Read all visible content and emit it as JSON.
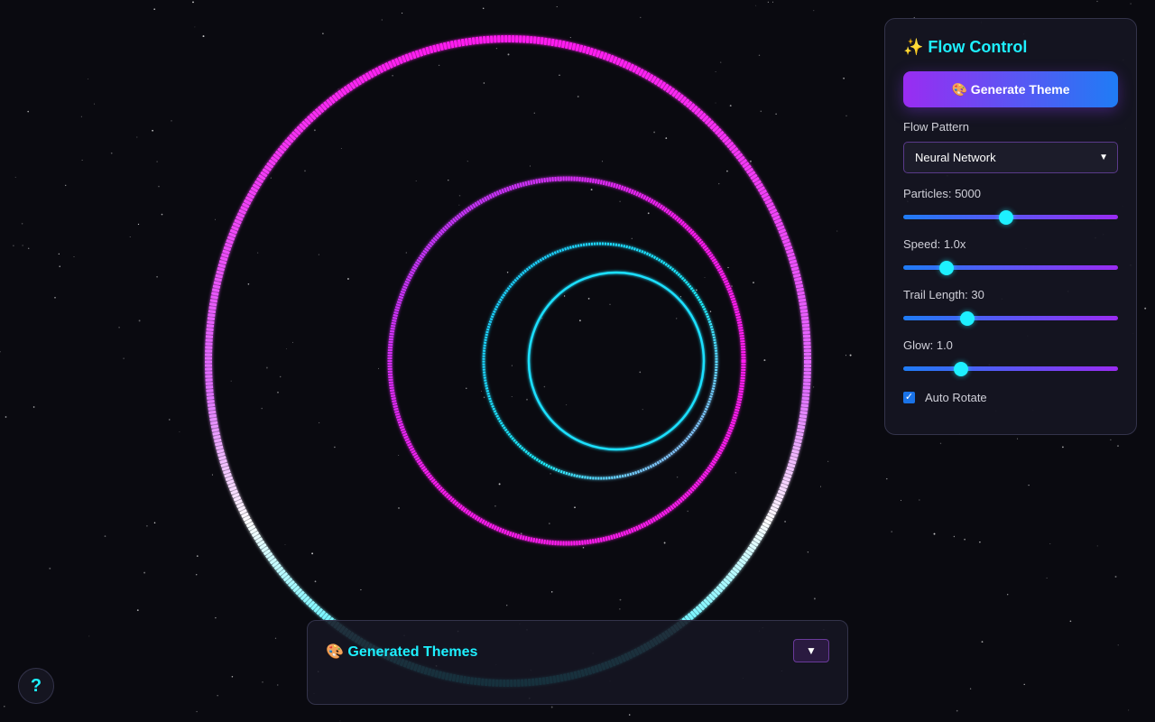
{
  "control_panel": {
    "title": "✨ Flow Control",
    "generate_button": "🎨 Generate Theme",
    "flow_pattern": {
      "label": "Flow Pattern",
      "selected": "Neural Network"
    },
    "sliders": [
      {
        "label": "Particles: 5000",
        "fraction": 0.48
      },
      {
        "label": "Speed: 1.0x",
        "fraction": 0.2
      },
      {
        "label": "Trail Length: 30",
        "fraction": 0.3
      },
      {
        "label": "Glow: 1.0",
        "fraction": 0.27
      }
    ],
    "auto_rotate": {
      "label": "Auto Rotate",
      "checked": true
    }
  },
  "themes_panel": {
    "title": "🎨 Generated Themes",
    "toggle": "▼"
  },
  "help_button": "?",
  "colors": {
    "accent": "#1ef0ff",
    "magenta": "#ff1cf0",
    "purple": "#9a2cf2",
    "blue": "#1f7cf5",
    "background": "#0a0a10"
  },
  "icons": {
    "select": "chevron-down-icon",
    "toggle": "triangle-down-icon"
  }
}
